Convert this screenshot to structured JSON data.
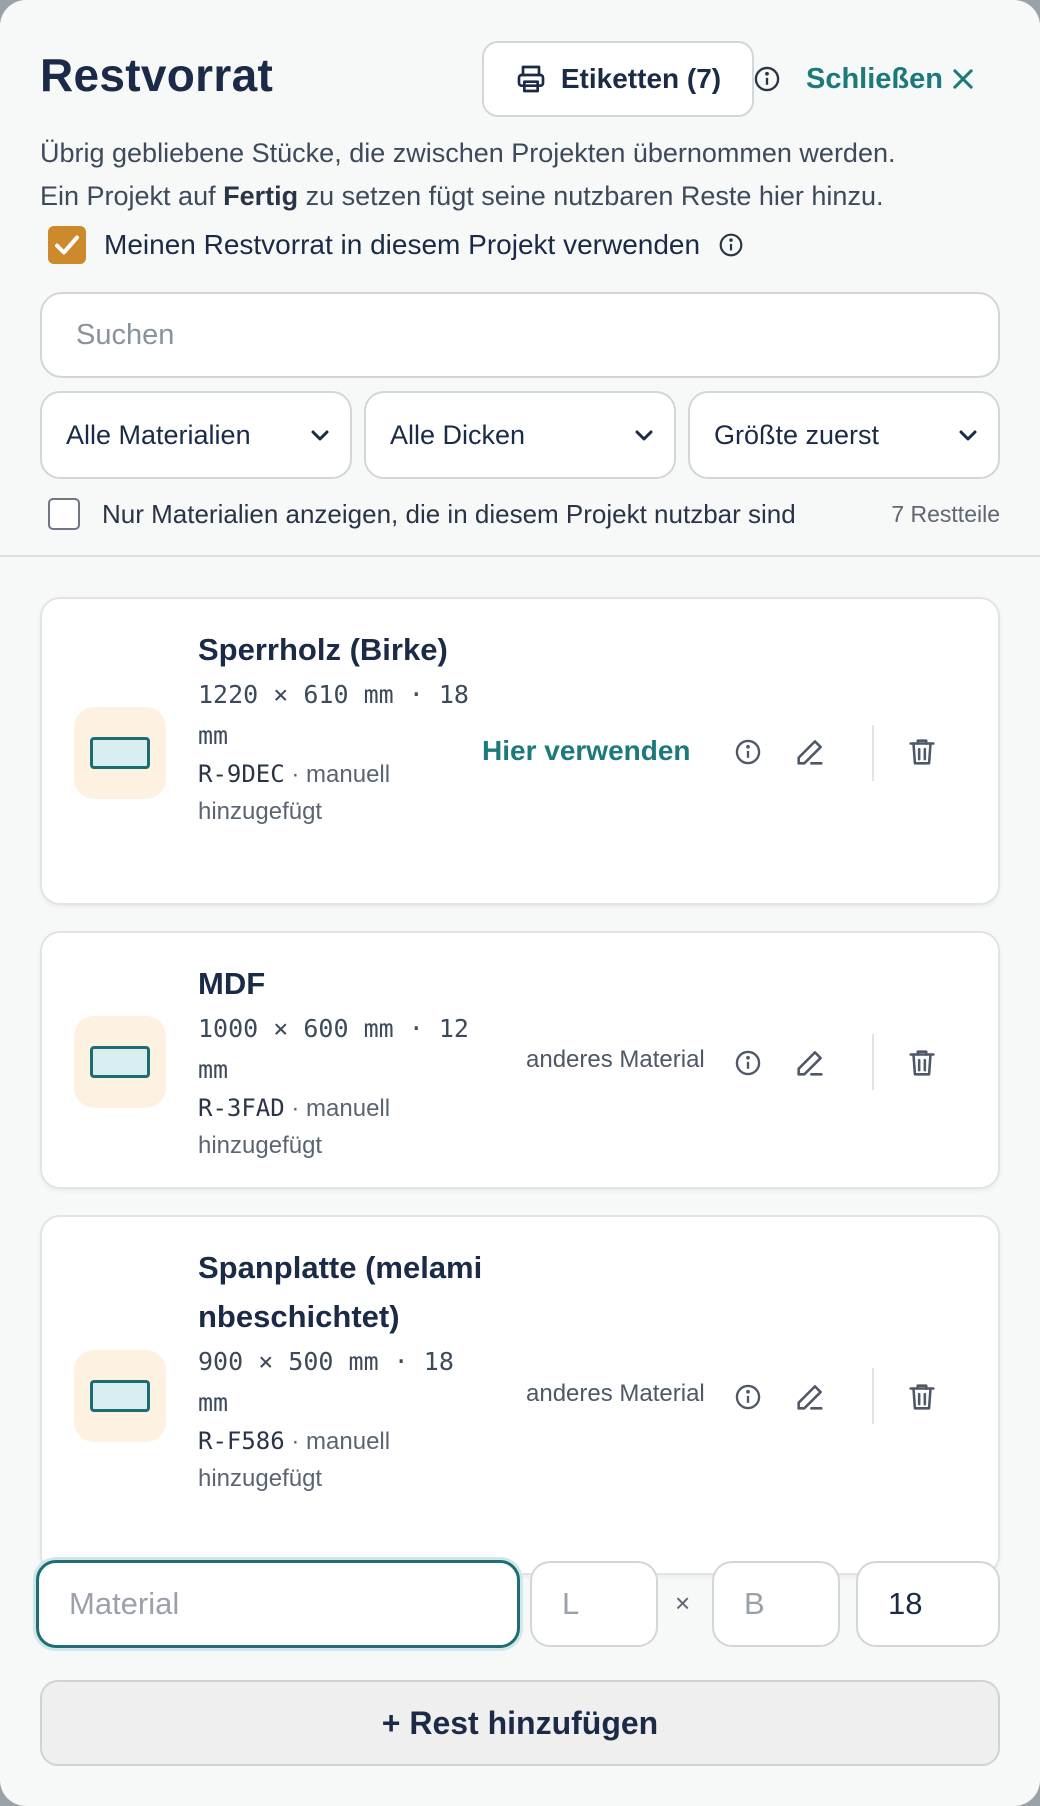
{
  "header": {
    "title": "Restvorrat",
    "labels_button": "Etiketten (7)",
    "close_label": "Schließen",
    "description_line1": "Übrig gebliebene Stücke, die zwischen Projekten übernommen werden.",
    "description_line2_pre": "Ein Projekt auf ",
    "description_line2_bold": "Fertig",
    "description_line2_post": " zu setzen fügt seine nutzbaren Reste hier hinzu.",
    "use_stock_label": "Meinen Restvorrat in diesem Projekt verwenden",
    "use_stock_checked": true
  },
  "search": {
    "placeholder": "Suchen"
  },
  "filters": {
    "material": "Alle Materialien",
    "thickness": "Alle Dicken",
    "sort": "Größte zuerst",
    "only_usable_label": "Nur Materialien anzeigen, die in diesem Projekt nutzbar sind",
    "only_usable_checked": false,
    "count": "7 Restteile"
  },
  "items": [
    {
      "name": "Sperrholz (Birke)",
      "dims": "1220 × 610 mm · 18 mm",
      "code": "R-9DEC",
      "source": " · manuell hinzugefügt",
      "action": "Hier verwenden",
      "usable": true
    },
    {
      "name": "MDF",
      "dims": "1000 × 600 mm · 12 mm",
      "code": "R-3FAD",
      "source": " · manuell hinzugefügt",
      "action": "anderes Material",
      "usable": false
    },
    {
      "name": "Spanplatte (melaminbeschichtet)",
      "dims": "900 × 500 mm · 18 mm",
      "code": "R-F586",
      "source": " · manuell hinzugefügt",
      "action": "anderes Material",
      "usable": false
    }
  ],
  "add_form": {
    "material_placeholder": "Material",
    "length_placeholder": "L",
    "times": "×",
    "width_placeholder": "B",
    "thickness_value": "18",
    "add_button": "+ Rest hinzufügen"
  },
  "colors": {
    "accent_teal": "#1d7a7a",
    "checkbox_orange": "#cc8a2c",
    "title": "#1b2a47"
  }
}
